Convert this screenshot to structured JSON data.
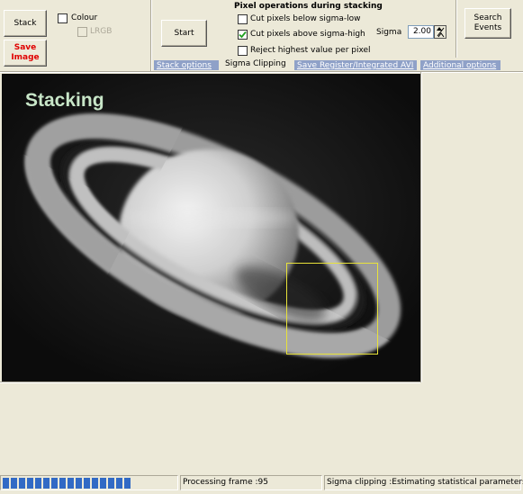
{
  "toolbar": {
    "stack_label": "Stack",
    "colour_label": "Colour",
    "lrgb_label": "LRGB",
    "save_image_label": "Save Image",
    "start_label": "Start",
    "search_events_label": "Search Events"
  },
  "pixel_ops": {
    "title": "Pixel operations during stacking",
    "options": [
      {
        "label": "Cut pixels below sigma-low",
        "checked": false
      },
      {
        "label": "Cut pixels above sigma-high",
        "checked": true
      },
      {
        "label": "Reject highest value per pixel",
        "checked": false
      }
    ],
    "sigma_label": "Sigma",
    "sigma_value": "2.00"
  },
  "tabs": [
    {
      "label": "Stack  options",
      "active": false
    },
    {
      "label": "Sigma Clipping",
      "active": true
    },
    {
      "label": "Save Register/Integrated AVI",
      "active": false
    },
    {
      "label": "Additional options",
      "active": false
    }
  ],
  "image": {
    "overlay_text": "Stacking"
  },
  "status": {
    "progress": 0.75,
    "frame_text": "Processing frame :95",
    "message_text": "Sigma clipping :Estimating statistical parameters"
  },
  "colors": {
    "progress": "#316ac5",
    "tab_inactive": "#8fa1c8",
    "roi_box": "#e8e23a"
  }
}
